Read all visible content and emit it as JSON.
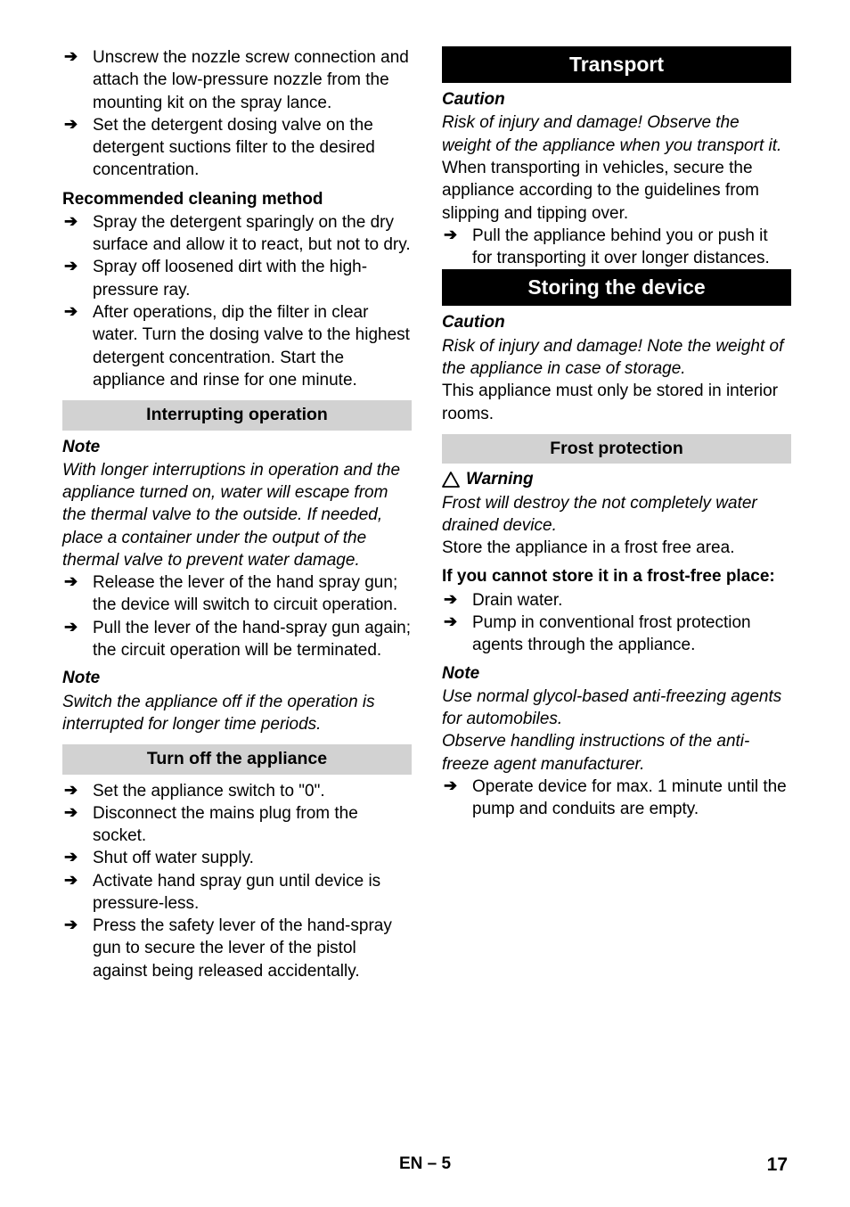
{
  "document": {
    "footer": {
      "center": "EN – 5",
      "page_number": "17"
    },
    "bullet_glyph": "➔"
  },
  "left_column": {
    "items_top": [
      "Unscrew the nozzle screw connection and attach the low-pressure nozzle from the mounting kit on the spray lance.",
      "Set the detergent dosing valve on the detergent suctions filter to the desired concentration."
    ],
    "recommended_heading": "Recommended cleaning method",
    "recommended_items": [
      "Spray the detergent sparingly on the dry surface and allow it to react, but not to dry.",
      "Spray off loosened dirt with the high-pressure ray.",
      "After operations, dip the filter in clear water. Turn the dosing valve to the highest detergent concentration. Start the appliance and rinse for one minute."
    ],
    "interrupting": {
      "title": "Interrupting operation",
      "note_label": "Note",
      "note_text": "With longer interruptions in operation and the appliance turned on, water will escape from the thermal valve to the outside. If needed, place a container under the output of the thermal valve to prevent water damage.",
      "items": [
        "Release the lever of the hand spray gun; the device will switch to circuit operation.",
        "Pull the lever of the hand-spray gun again; the circuit operation will be terminated."
      ],
      "note2_label": "Note",
      "note2_text": "Switch the appliance off if the operation is interrupted for longer time periods."
    },
    "turn_off": {
      "title": "Turn off the appliance",
      "items": [
        "Set the appliance switch to \"0\".",
        "Disconnect the mains plug from the socket.",
        "Shut off water supply.",
        "Activate hand spray gun until device is pressure-less.",
        "Press the safety lever of the hand-spray gun to secure the lever of the pistol against being released accidentally."
      ]
    }
  },
  "right_column": {
    "transport": {
      "title": "Transport",
      "caution_label": "Caution",
      "caution_text": "Risk of injury and damage! Observe the weight of the appliance when you transport it.",
      "body_text": "When transporting in vehicles, secure the appliance according to the guidelines from slipping and tipping over.",
      "items": [
        "Pull the appliance behind you or push it for transporting it over longer distances."
      ]
    },
    "storing": {
      "title": "Storing the device",
      "caution_label": "Caution",
      "caution_text": "Risk of injury and damage! Note the weight of the appliance in case of storage.",
      "body_text": "This appliance must only be stored in interior rooms."
    },
    "frost": {
      "title": "Frost protection",
      "warning_label": "Warning",
      "warning_text": "Frost will destroy the not completely water drained device.",
      "body_text": "Store the appliance in a frost free area.",
      "subheading": "If you cannot store it in a frost-free place:",
      "items": [
        "Drain water.",
        "Pump in conventional frost protection agents through the appliance."
      ],
      "note_label": "Note",
      "note_text_1": "Use normal glycol-based anti-freezing agents for automobiles.",
      "note_text_2": "Observe handling instructions of the anti-freeze agent manufacturer.",
      "items_2": [
        "Operate device for max. 1 minute until the pump and conduits are empty."
      ]
    }
  }
}
